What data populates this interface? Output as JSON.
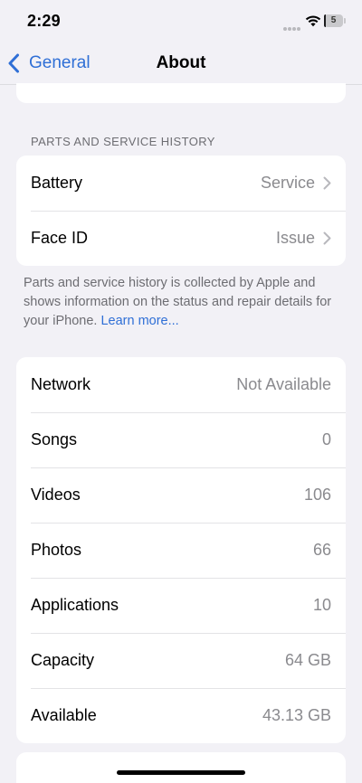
{
  "status_bar": {
    "time": "2:29",
    "battery_percent": "5",
    "battery_level": 0.05,
    "icons": [
      "signal-dots-icon",
      "wifi-icon",
      "battery-icon"
    ]
  },
  "nav": {
    "back_label": "General",
    "title": "About",
    "accent_color": "#2f6fd6"
  },
  "parts_section": {
    "header": "PARTS AND SERVICE HISTORY",
    "rows": [
      {
        "label": "Battery",
        "value": "Service"
      },
      {
        "label": "Face ID",
        "value": "Issue"
      }
    ],
    "footer_text": "Parts and service history is collected by Apple and shows information on the status and repair details for your iPhone. ",
    "learn_more": "Learn more..."
  },
  "info_section": {
    "rows": [
      {
        "label": "Network",
        "value": "Not Available"
      },
      {
        "label": "Songs",
        "value": "0"
      },
      {
        "label": "Videos",
        "value": "106"
      },
      {
        "label": "Photos",
        "value": "66"
      },
      {
        "label": "Applications",
        "value": "10"
      },
      {
        "label": "Capacity",
        "value": "64 GB"
      },
      {
        "label": "Available",
        "value": "43.13 GB"
      }
    ]
  }
}
